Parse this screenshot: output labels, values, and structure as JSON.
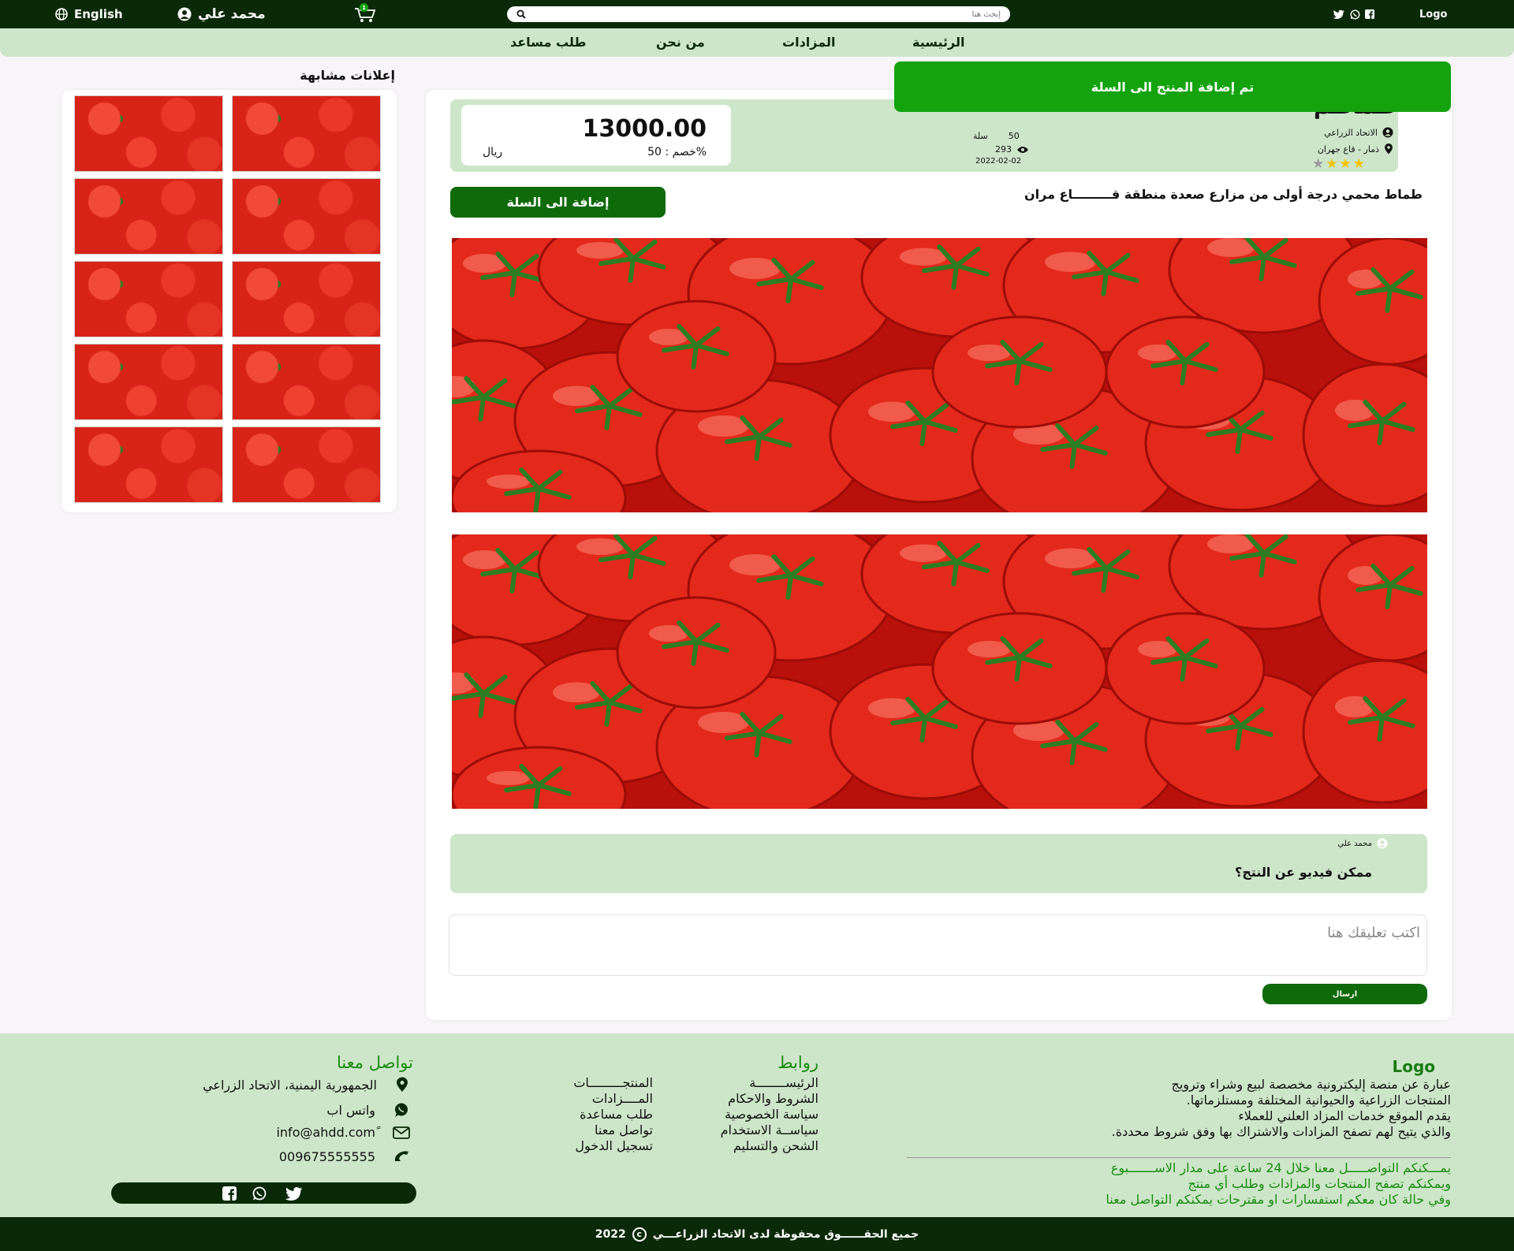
{
  "topbar": {
    "language": "English",
    "user_name": "محمد علي",
    "cart_count": "1",
    "search_placeholder": "إبحث هنا",
    "logo": "Logo"
  },
  "nav": {
    "items": [
      "الرئيسية",
      "المزادات",
      "من نحن",
      "طلب مساعد"
    ]
  },
  "toast": "تم إضافة المنتج الى السلة",
  "sidebar": {
    "title": "إعلانات مشابهة",
    "thumb_count": 10
  },
  "product": {
    "title": "طماطم",
    "price": "13000.00",
    "discount": "خصم : 50%",
    "currency": "ريال",
    "seller": "الاتحاد الزراعي",
    "location": "ذمار - قاع جهران",
    "quantity": "50",
    "unit": "سلة",
    "views": "293",
    "date": "2022-02-02",
    "rating": 3,
    "rating_max": 4,
    "description": "طماط محمي درجة أولى من مزارع صعدة منطقة قـــــــــاع مران",
    "add_to_cart": "إضافة الى السلة"
  },
  "comments": {
    "items": [
      {
        "author": "محمد علي",
        "text": "ممكن فيديو عن النتج؟"
      }
    ],
    "placeholder": "اكتب تعليقك هنا",
    "send_label": "ارسال"
  },
  "footer": {
    "logo": "Logo",
    "about_lines": [
      "عبارة عن منصة إليكترونية مخصصة لبيع وشراء وترويج",
      ".المنتجات الزراعية والحيوانية المختلفة ومستلزماتها",
      "يقدم الموقع خدمات المزاد العلني للعملاء",
      ".والذي يتيح لهم تصفح المزادات والاشتراك بها وفق شروط محددة"
    ],
    "green_lines": [
      "يمـــكنكم التواصـــــل معنا خلال 24 ساعة على مدار الاســـــــبوع",
      "ويمكنكم تصفح المنتجات والمزادات وطلب أي منتج",
      "وفي حالة كان معكم استفسارات او مقترحات يمكنكم التواصل معنا"
    ],
    "links_title": "روابط",
    "links_col1": [
      "الرئيســــــــة",
      "الشروط والاحكام",
      "سياسة الخصوصية",
      "سياســة الاستخدام",
      "الشحن والتسليم"
    ],
    "links_col2": [
      "المنتجـــــــــات",
      "المــــزادات",
      "طلب مساعدة",
      "تواصل معنا",
      "تسجيل الدخول"
    ],
    "contact_title": "تواصل معنا",
    "address": "الجمهورية اليمنية، الاتحاد الزراعي",
    "whatsapp": "واتس اب",
    "email": "info@ahdd.comً",
    "phone": "009675555555",
    "copyright": "جميع الحقــــــوق محفوظة لدى الاتحاد الزراعـــي",
    "year": "2022"
  },
  "colors": {
    "dark_green": "#0a2a07",
    "light_green": "#cde6c9",
    "accent_green": "#14a30f",
    "button_green": "#0f6a0a",
    "star_gold": "#f2c200"
  }
}
